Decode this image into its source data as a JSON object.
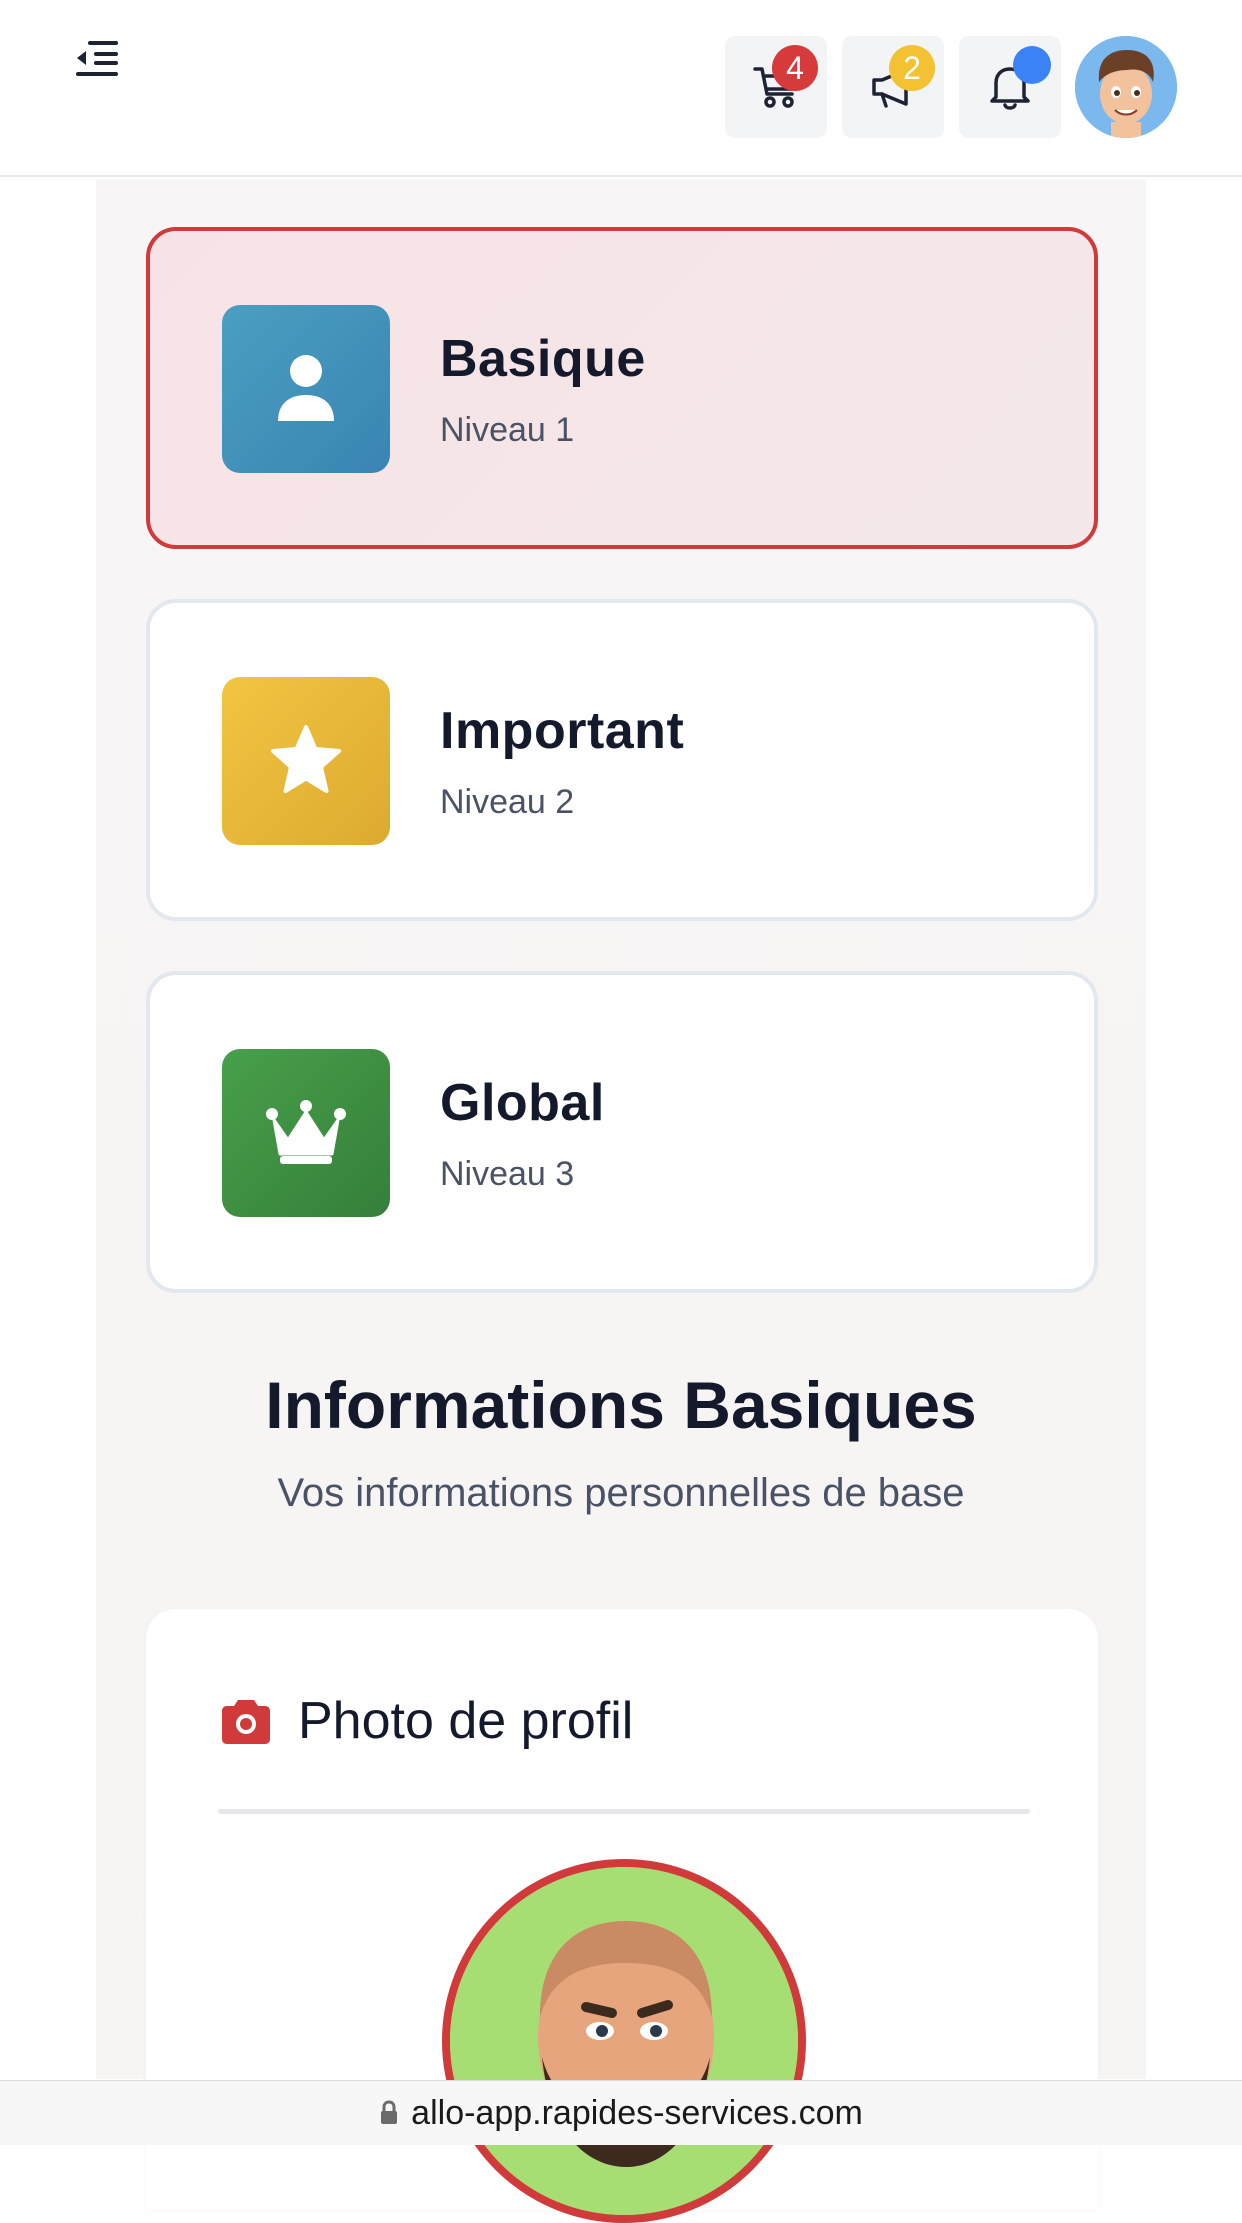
{
  "header": {
    "cart_badge": "4",
    "promo_badge": "2"
  },
  "levels": [
    {
      "title": "Basique",
      "subtitle": "Niveau 1",
      "icon": "user-icon",
      "color": "#3a8dbb",
      "selected": true
    },
    {
      "title": "Important",
      "subtitle": "Niveau 2",
      "icon": "star-icon",
      "color": "#e8b73a",
      "selected": false
    },
    {
      "title": "Global",
      "subtitle": "Niveau 3",
      "icon": "crown-icon",
      "color": "#3f8f42",
      "selected": false
    }
  ],
  "section": {
    "title": "Informations Basiques",
    "subtitle": "Vos informations personnelles de base"
  },
  "photo_card": {
    "title": "Photo de profil",
    "icon": "camera-icon"
  },
  "browser": {
    "url": "allo-app.rapides-services.com"
  },
  "colors": {
    "accent_red": "#d13a3a",
    "notification_blue": "#3b82f6",
    "badge_yellow": "#f2c233"
  }
}
